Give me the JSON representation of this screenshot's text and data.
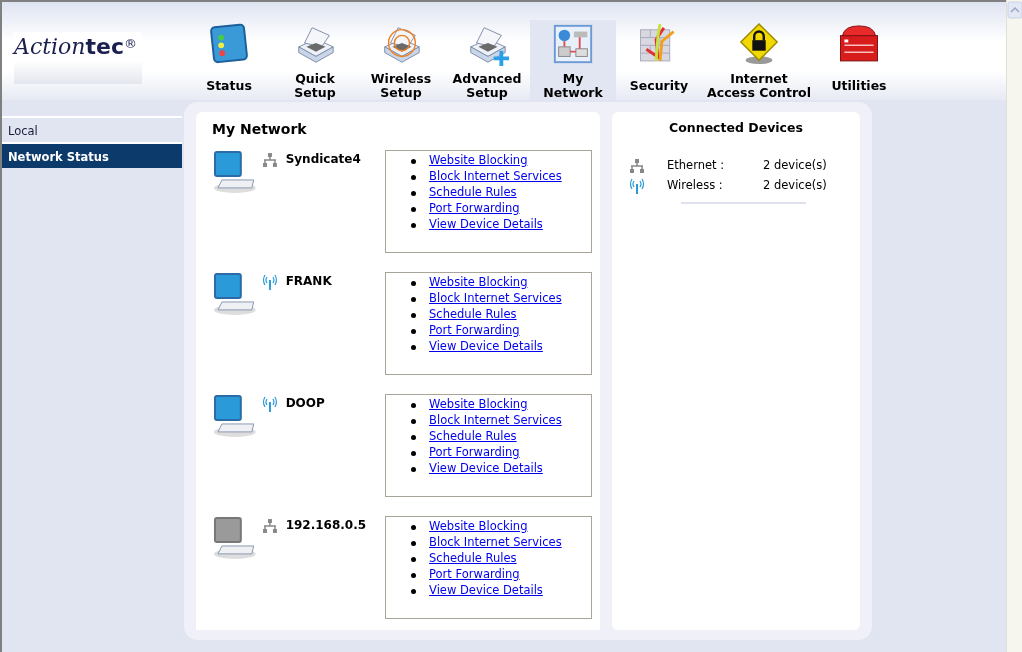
{
  "logo": {
    "text_script": "Action",
    "text_bold": "tec",
    "mark": "®"
  },
  "nav": [
    {
      "label": "Status",
      "selected": false
    },
    {
      "label": "Quick Setup",
      "selected": false
    },
    {
      "label": "Wireless Setup",
      "selected": false
    },
    {
      "label": "Advanced Setup",
      "selected": false
    },
    {
      "label": "My Network",
      "selected": true
    },
    {
      "label": "Security",
      "selected": false
    },
    {
      "label": "Internet Access Control",
      "selected": false
    },
    {
      "label": "Utilities",
      "selected": false
    }
  ],
  "sidebar": {
    "items": [
      {
        "label": "Local",
        "selected": false
      },
      {
        "label": "Network Status",
        "selected": true
      }
    ]
  },
  "my_network": {
    "title": "My Network",
    "devices": [
      {
        "name": "Syndicate4",
        "kind": "wired",
        "online": true,
        "links": [
          "Website Blocking",
          "Block Internet Services",
          "Schedule Rules",
          "Port Forwarding",
          "View Device Details"
        ]
      },
      {
        "name": "FRANK",
        "kind": "wireless",
        "online": true,
        "links": [
          "Website Blocking",
          "Block Internet Services",
          "Schedule Rules",
          "Port Forwarding",
          "View Device Details"
        ]
      },
      {
        "name": "DOOP",
        "kind": "wireless",
        "online": true,
        "links": [
          "Website Blocking",
          "Block Internet Services",
          "Schedule Rules",
          "Port Forwarding",
          "View Device Details"
        ]
      },
      {
        "name": "192.168.0.5",
        "kind": "wired",
        "online": false,
        "links": [
          "Website Blocking",
          "Block Internet Services",
          "Schedule Rules",
          "Port Forwarding",
          "View Device Details"
        ]
      }
    ]
  },
  "connected_devices": {
    "title": "Connected Devices",
    "rows": [
      {
        "kind": "wired",
        "label": "Ethernet :",
        "value": "2 device(s)"
      },
      {
        "kind": "wireless",
        "label": "Wireless :",
        "value": "2 device(s)"
      }
    ]
  }
}
